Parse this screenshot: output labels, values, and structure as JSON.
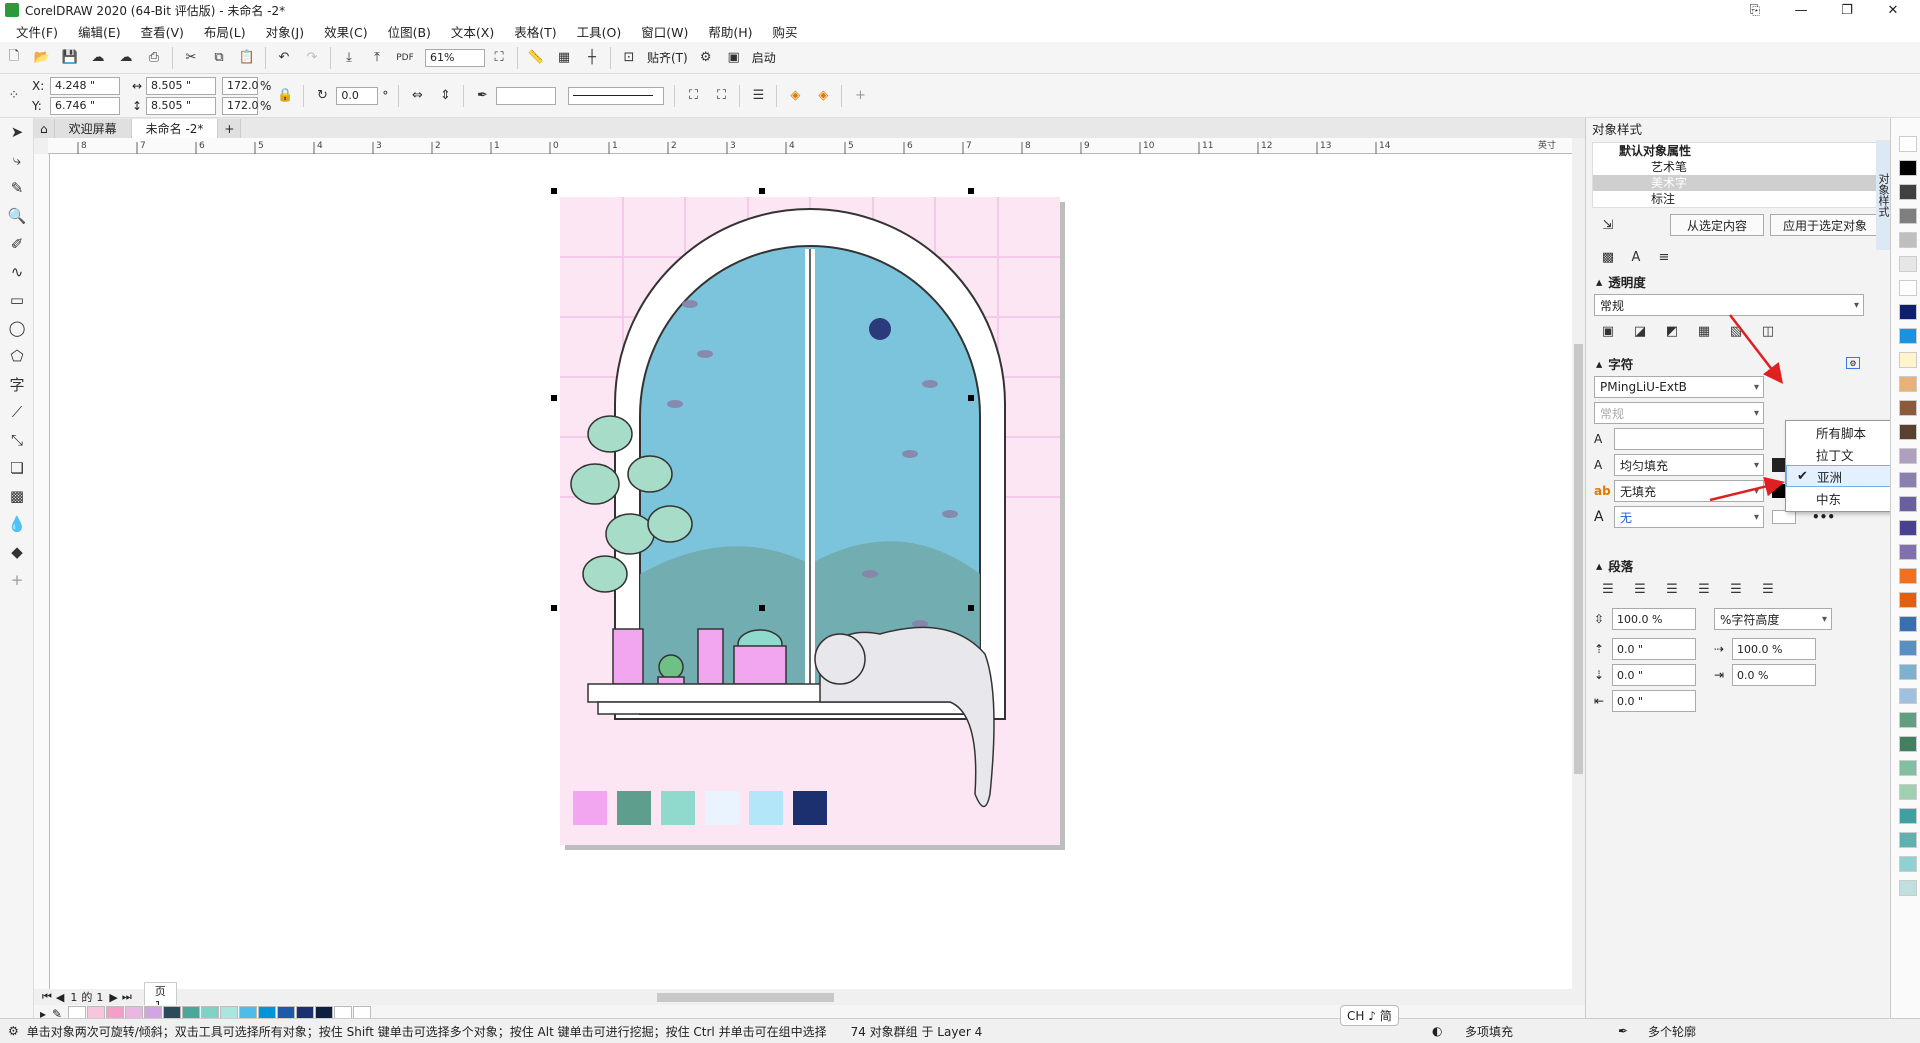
{
  "window": {
    "title": "CorelDRAW 2020 (64-Bit 评估版) - 未命名 -2*",
    "controls": [
      "⎘",
      "—",
      "❐",
      "✕"
    ]
  },
  "menu": [
    "文件(F)",
    "编辑(E)",
    "查看(V)",
    "布局(L)",
    "对象(J)",
    "效果(C)",
    "位图(B)",
    "文本(X)",
    "表格(T)",
    "工具(O)",
    "窗口(W)",
    "帮助(H)",
    "购买"
  ],
  "toolbar1": {
    "zoom": "61%",
    "snap_label": "贴齐(T)",
    "launch_label": "启动"
  },
  "toolbar2": {
    "x": "4.248 \"",
    "y": "6.746 \"",
    "w": "8.505 \"",
    "h": "8.505 \"",
    "sx": "172.0",
    "sy": "172.0",
    "pct": "%",
    "angle": "0.0",
    "angle_unit": "°",
    "x_label": "X:",
    "y_label": "Y:"
  },
  "doc_tabs": [
    "欢迎屏幕",
    "未命名 -2*"
  ],
  "ruler_ticks": [
    "8",
    "7",
    "6",
    "5",
    "4",
    "3",
    "2",
    "1",
    "0",
    "1",
    "2",
    "3",
    "4",
    "5",
    "6",
    "7",
    "8",
    "9",
    "10",
    "11",
    "12",
    "13",
    "14"
  ],
  "ruler_unit": "英寸",
  "page_nav": {
    "current": "1",
    "sep": "的",
    "total": "1",
    "page_tab": "页 1"
  },
  "status": {
    "hint": "单击对象两次可旋转/倾斜；双击工具可选择所有对象；按住 Shift 键单击可选择多个对象；按住 Alt 键单击可进行挖掘；按住 Ctrl 并单击可在组中选择",
    "selection": "74 对象群组 于 Layer 4",
    "ime": "CH ♪ 简",
    "fill": "多项填充",
    "outline": "多个轮廓"
  },
  "docker": {
    "title": "对象样式",
    "tree": {
      "root": "默认对象属性",
      "items": [
        "艺术笔",
        "美术字",
        "标注"
      ]
    },
    "from_selection": "从选定内容",
    "apply_to_selected": "应用于选定对象",
    "transparency": {
      "title": "透明度",
      "mode": "常规"
    },
    "character": {
      "title": "字符",
      "font": "PMingLiU-ExtB",
      "style": "常规",
      "fill": "均匀填充",
      "bg_fill": "无填充",
      "outline": "无"
    },
    "paragraph": {
      "title": "段落",
      "line_spacing": "100.0 %",
      "line_spacing_unit": "%字符高度",
      "before": "0.0 \"",
      "after": "0.0 \"",
      "char_spacing": "100.0 %",
      "word_spacing": "0.0 %",
      "indent": "0.0 \""
    },
    "vertical_tab": "对象样式"
  },
  "script_popup": {
    "items": [
      "所有脚本",
      "拉丁文",
      "亚洲",
      "中东"
    ],
    "checked": "亚洲"
  },
  "palette_colors": [
    "#ffffff",
    "#f7c6dd",
    "#f3a0c8",
    "#e9b7e0",
    "#cfa6e0",
    "#2b4a5a",
    "#4aa79a",
    "#7fd3c4",
    "#a8e6e0",
    "#4dbce9",
    "#0095d9",
    "#1e5aa8",
    "#1c2f6e",
    "#0f1f40",
    "#ffffff",
    "#ffffff"
  ],
  "right_palette": [
    "#ffffff",
    "#000000",
    "#404040",
    "#7f7f7f",
    "#bfbfbf",
    "#e6e6e6",
    "#ffffff",
    "#0f1f6e",
    "#1e90e0",
    "#fff4cc",
    "#e8b07a",
    "#8a5a3a",
    "#5a4030",
    "#b0a0c0",
    "#8a80b0",
    "#6a60a0",
    "#4a4090",
    "#8070b0",
    "#f07020",
    "#e06010",
    "#3a70b0",
    "#5a90c0",
    "#80b0d0",
    "#a0c0e0",
    "#60a080",
    "#408060",
    "#80c0a0",
    "#a0d0b0",
    "#40a0a0",
    "#60b0b0",
    "#90d0d0",
    "#c0e0e0"
  ],
  "artwork_swatches": [
    "#f2a6f0",
    "#5e9e8c",
    "#8fdacd",
    "#eaf4ff",
    "#b4e6fa",
    "#1c2f6e"
  ]
}
